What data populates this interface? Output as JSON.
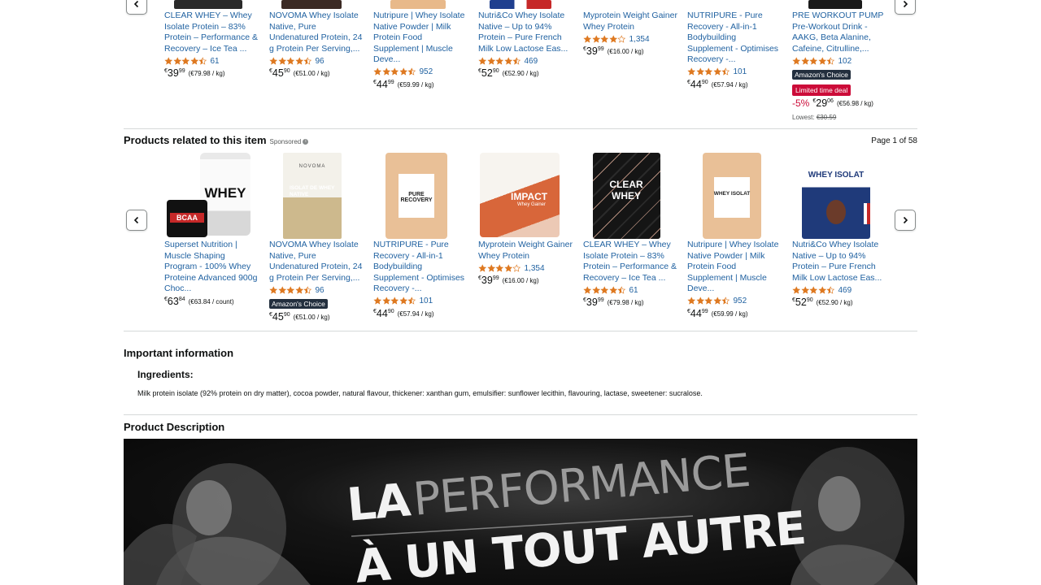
{
  "top_carousel": {
    "items": [
      {
        "title": "CLEAR WHEY – Whey Isolate Protein – 83% Protein – Performance & Recovery – Ice Tea ...",
        "stars": 4.5,
        "count": "61",
        "cur": "€",
        "whole": "39",
        "frac": "99",
        "unit": "(€79.98 / kg)"
      },
      {
        "title": "NOVOMA Whey Isolate Native, Pure Undenatured Protein, 24 g Protein Per Serving,...",
        "stars": 4.5,
        "count": "96",
        "cur": "€",
        "whole": "45",
        "frac": "90",
        "unit": "(€51.00 / kg)"
      },
      {
        "title": "Nutripure | Whey Isolate Native Powder | Milk Protein Food Supplement | Muscle Deve...",
        "stars": 4.5,
        "count": "952",
        "cur": "€",
        "whole": "44",
        "frac": "99",
        "unit": "(€59.99 / kg)"
      },
      {
        "title": "Nutri&Co Whey Isolate Native – Up to 94% Protein – Pure French Milk Low Lactose Eas...",
        "stars": 4.5,
        "count": "469",
        "cur": "€",
        "whole": "52",
        "frac": "90",
        "unit": "(€52.90 / kg)"
      },
      {
        "title": "Myprotein Weight Gainer Whey Protein",
        "stars": 4,
        "count": "1,354",
        "cur": "€",
        "whole": "39",
        "frac": "99",
        "unit": "(€16.00 / kg)"
      },
      {
        "title": "NUTRIPURE - Pure Recovery - All-in-1 Bodybuilding Supplement - Optimises Recovery -...",
        "stars": 4.5,
        "count": "101",
        "cur": "€",
        "whole": "44",
        "frac": "90",
        "unit": "(€57.94 / kg)"
      },
      {
        "title": "PRE WORKOUT PUMP Pre-Workout Drink - AAKG, Beta Alanine, Cafeine, Citrulline,...",
        "stars": 4.5,
        "count": "102",
        "badge": "Amazon's Choice",
        "deal": "Limited time deal",
        "discount": "-5%",
        "cur": "€",
        "whole": "29",
        "frac": "06",
        "unit": "(€56.98 / kg)",
        "lowest_label": "Lowest:",
        "lowest_price": "€30.59"
      }
    ]
  },
  "related": {
    "title": "Products related to this item",
    "sponsored": "Sponsored",
    "pager": "Page 1 of 58",
    "items": [
      {
        "title": "Superset Nutrition | Muscle Shaping Program - 100% Whey Proteine Advanced 900g Choc...",
        "cur": "€",
        "whole": "63",
        "frac": "84",
        "unit": "(€63.84 / count)",
        "img_text": "WHEY",
        "img_text2": "BCAA"
      },
      {
        "title": "NOVOMA Whey Isolate Native, Pure Undenatured Protein, 24 g Protein Per Serving,...",
        "stars": 4.5,
        "count": "96",
        "badge": "Amazon's Choice",
        "cur": "€",
        "whole": "45",
        "frac": "90",
        "unit": "(€51.00 / kg)",
        "img_text": "ISOLAT DE WHEY NATIVE",
        "img_brand": "NOVOMA"
      },
      {
        "title": "NUTRIPURE - Pure Recovery - All-in-1 Bodybuilding Supplement - Optimises Recovery -...",
        "stars": 4.5,
        "count": "101",
        "cur": "€",
        "whole": "44",
        "frac": "90",
        "unit": "(€57.94 / kg)",
        "img_text": "PURE RECOVERY"
      },
      {
        "title": "Myprotein Weight Gainer Whey Protein",
        "stars": 4,
        "count": "1,354",
        "cur": "€",
        "whole": "39",
        "frac": "99",
        "unit": "(€16.00 / kg)",
        "img_text": "IMPACT",
        "img_text2": "Whey Gainer"
      },
      {
        "title": "CLEAR WHEY – Whey Isolate Protein – 83% Protein – Performance & Recovery – Ice Tea ...",
        "stars": 4.5,
        "count": "61",
        "cur": "€",
        "whole": "39",
        "frac": "99",
        "unit": "(€79.98 / kg)",
        "img_text": "CLEAR WHEY"
      },
      {
        "title": "Nutripure | Whey Isolate Native Powder | Milk Protein Food Supplement | Muscle Deve...",
        "stars": 4.5,
        "count": "952",
        "cur": "€",
        "whole": "44",
        "frac": "99",
        "unit": "(€59.99 / kg)",
        "img_text": "WHEY ISOLAT"
      },
      {
        "title": "Nutri&Co Whey Isolate Native – Up to 94% Protein – Pure French Milk Low Lactose Eas...",
        "stars": 4.5,
        "count": "469",
        "cur": "€",
        "whole": "52",
        "frac": "90",
        "unit": "(€52.90 / kg)",
        "img_text": "WHEY ISOLAT"
      }
    ]
  },
  "important": {
    "title": "Important information",
    "ingredients_label": "Ingredients:",
    "ingredients_text": "Milk protein isolate (92% protein on dry matter), cocoa powder, natural flavour, thickener: xanthan gum, emulsifier: sunflower lecithin, flavouring, lactase, sweetener: sucralose."
  },
  "description": {
    "title": "Product Description",
    "hero_line1_a": "LA",
    "hero_line1_b": "PERFORMANCE",
    "hero_line2": "À UN TOUT AUTRE"
  },
  "colors": {
    "link": "#2162a1",
    "star": "#de7921",
    "deal": "#cc0c39",
    "choice": "#232f3e"
  }
}
